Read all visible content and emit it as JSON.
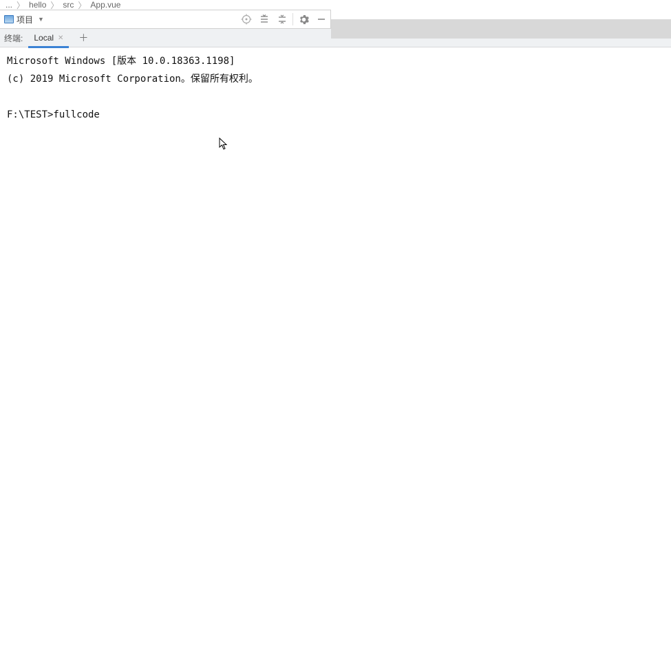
{
  "breadcrumb": {
    "items": [
      "...",
      "hello",
      "src",
      "App.vue"
    ]
  },
  "toolbar": {
    "project_label": "项目"
  },
  "terminal_tabs": {
    "label": "终端:",
    "active": "Local"
  },
  "terminal": {
    "line1": "Microsoft Windows [版本 10.0.18363.1198]",
    "line2": "(c) 2019 Microsoft Corporation。保留所有权利。",
    "blank": "",
    "prompt_line": "F:\\TEST>fullcode"
  }
}
